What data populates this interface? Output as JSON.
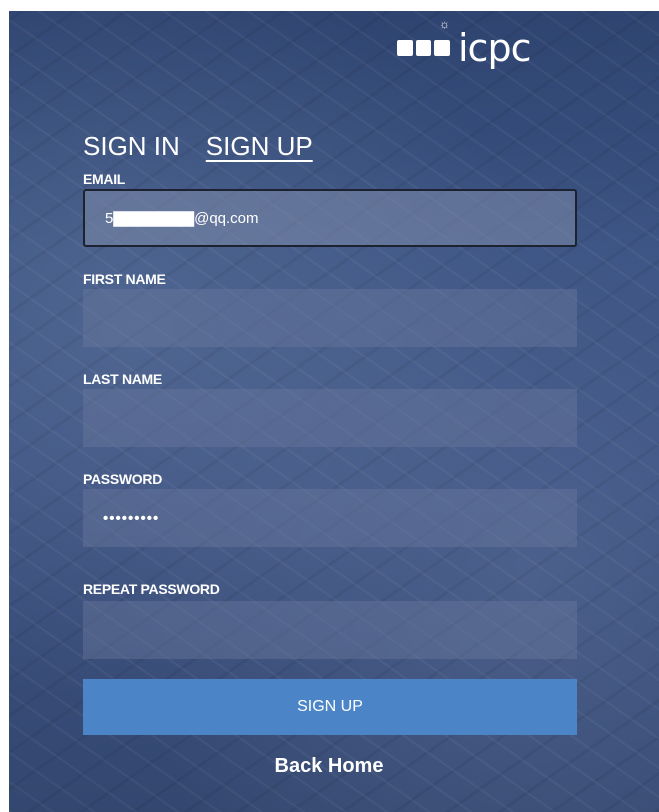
{
  "logo": {
    "text": "icpc"
  },
  "tabs": {
    "sign_in": "SIGN IN",
    "sign_up": "SIGN UP"
  },
  "form": {
    "email": {
      "label": "EMAIL",
      "value": "5▇▇▇▇▇▇▇@qq.com"
    },
    "first_name": {
      "label": "FIRST NAME",
      "value": ""
    },
    "last_name": {
      "label": "LAST NAME",
      "value": ""
    },
    "password": {
      "label": "PASSWORD",
      "value": "•••••••••"
    },
    "repeat_password": {
      "label": "REPEAT PASSWORD",
      "value": ""
    }
  },
  "submit_label": "SIGN UP",
  "back_home": "Back Home",
  "colors": {
    "accent": "#4b85c7",
    "background": "#3a5282"
  }
}
